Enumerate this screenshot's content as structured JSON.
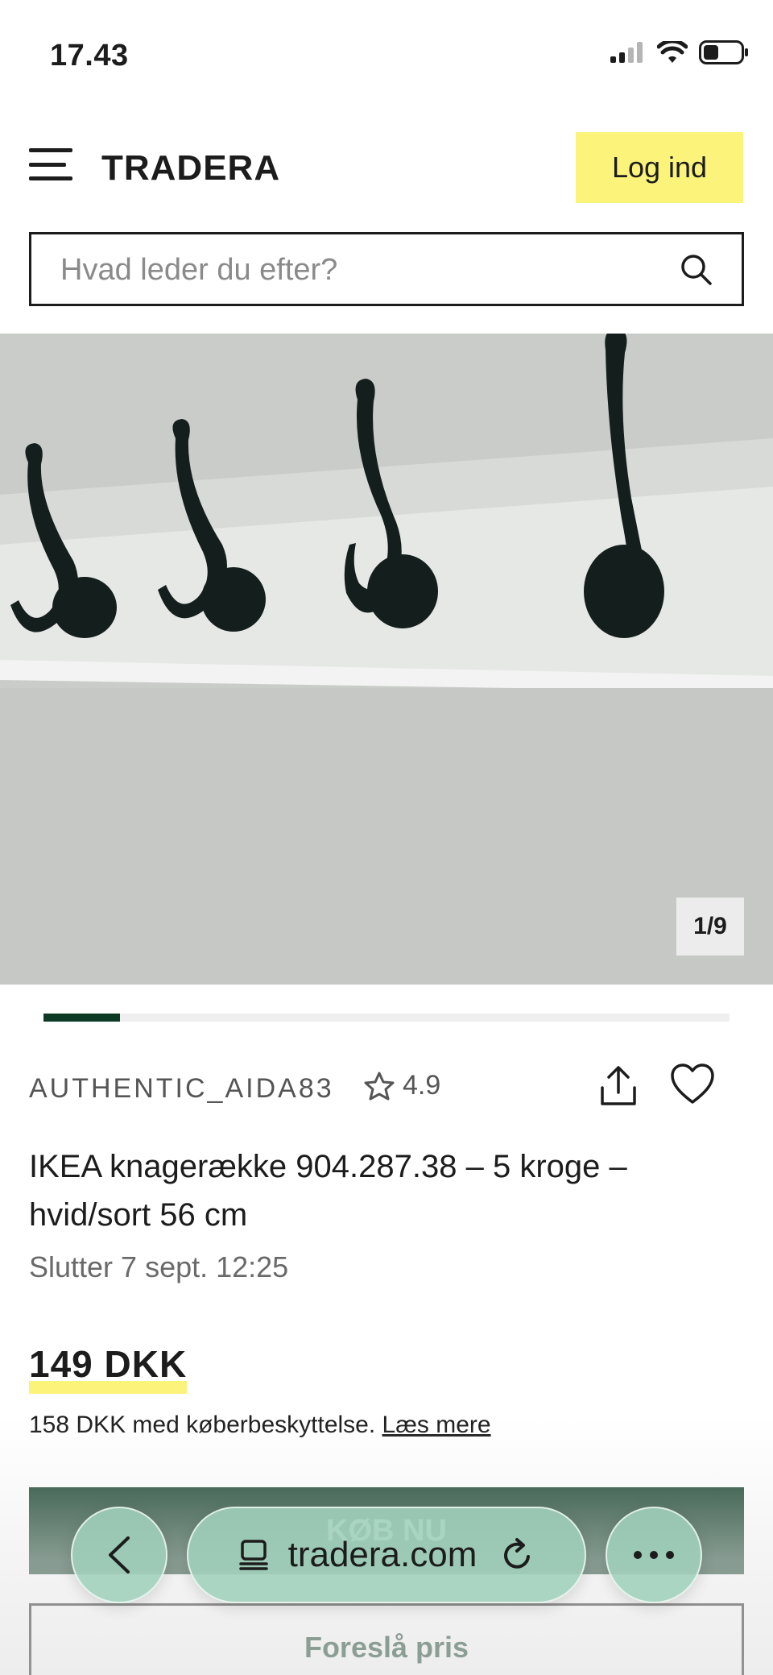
{
  "status_bar": {
    "time": "17.43"
  },
  "header": {
    "logo": "TRADERA",
    "login_label": "Log ind"
  },
  "search": {
    "placeholder": "Hvad leder du efter?"
  },
  "gallery": {
    "counter": "1/9",
    "current_image": 1,
    "total_images": 9,
    "progress_fraction": 0.111
  },
  "listing": {
    "seller": "AUTHENTIC_AIDA83",
    "rating": "4.9",
    "title": "IKEA knagerække 904.287.38 – 5 kroge – hvid/sort 56 cm",
    "ends": "Slutter 7 sept. 12:25",
    "price": "149 DKK",
    "protection_text": "158 DKK med køberbeskyttelse.",
    "protection_link": "Læs mere"
  },
  "actions": {
    "buy_label": "KØB NU",
    "offer_label": "Foreslå pris"
  },
  "browser": {
    "url": "tradera.com"
  },
  "colors": {
    "accent_yellow": "#fbf37a",
    "brand_green": "#0d3a24",
    "browser_pill": "#a0d0bc"
  }
}
